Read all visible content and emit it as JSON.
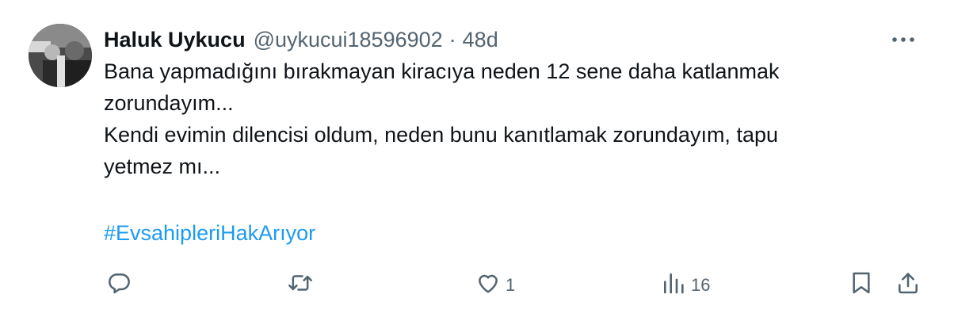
{
  "tweet": {
    "author": {
      "display_name": "Haluk Uykucu",
      "handle": "@uykucui18596902",
      "separator": "·",
      "time": "48d"
    },
    "text_lines": [
      "Bana yapmadığını bırakmayan kiracıya neden 12 sene daha katlanmak",
      "zorundayım...",
      "Kendi evimin dilencisi oldum, neden bunu kanıtlamak zorundayım, tapu",
      "yetmez mı..."
    ],
    "hashtag": "#EvsahipleriHakArıyor",
    "actions": {
      "reply_icon": "reply-icon",
      "retweet_icon": "retweet-icon",
      "like_icon": "heart-icon",
      "like_count": "1",
      "views_icon": "views-icon",
      "views_count": "16",
      "bookmark_icon": "bookmark-icon",
      "share_icon": "share-icon"
    },
    "more_icon": "more-icon"
  },
  "colors": {
    "text": "#0f1419",
    "secondary": "#536471",
    "link": "#1d9bf0",
    "background": "#ffffff"
  }
}
